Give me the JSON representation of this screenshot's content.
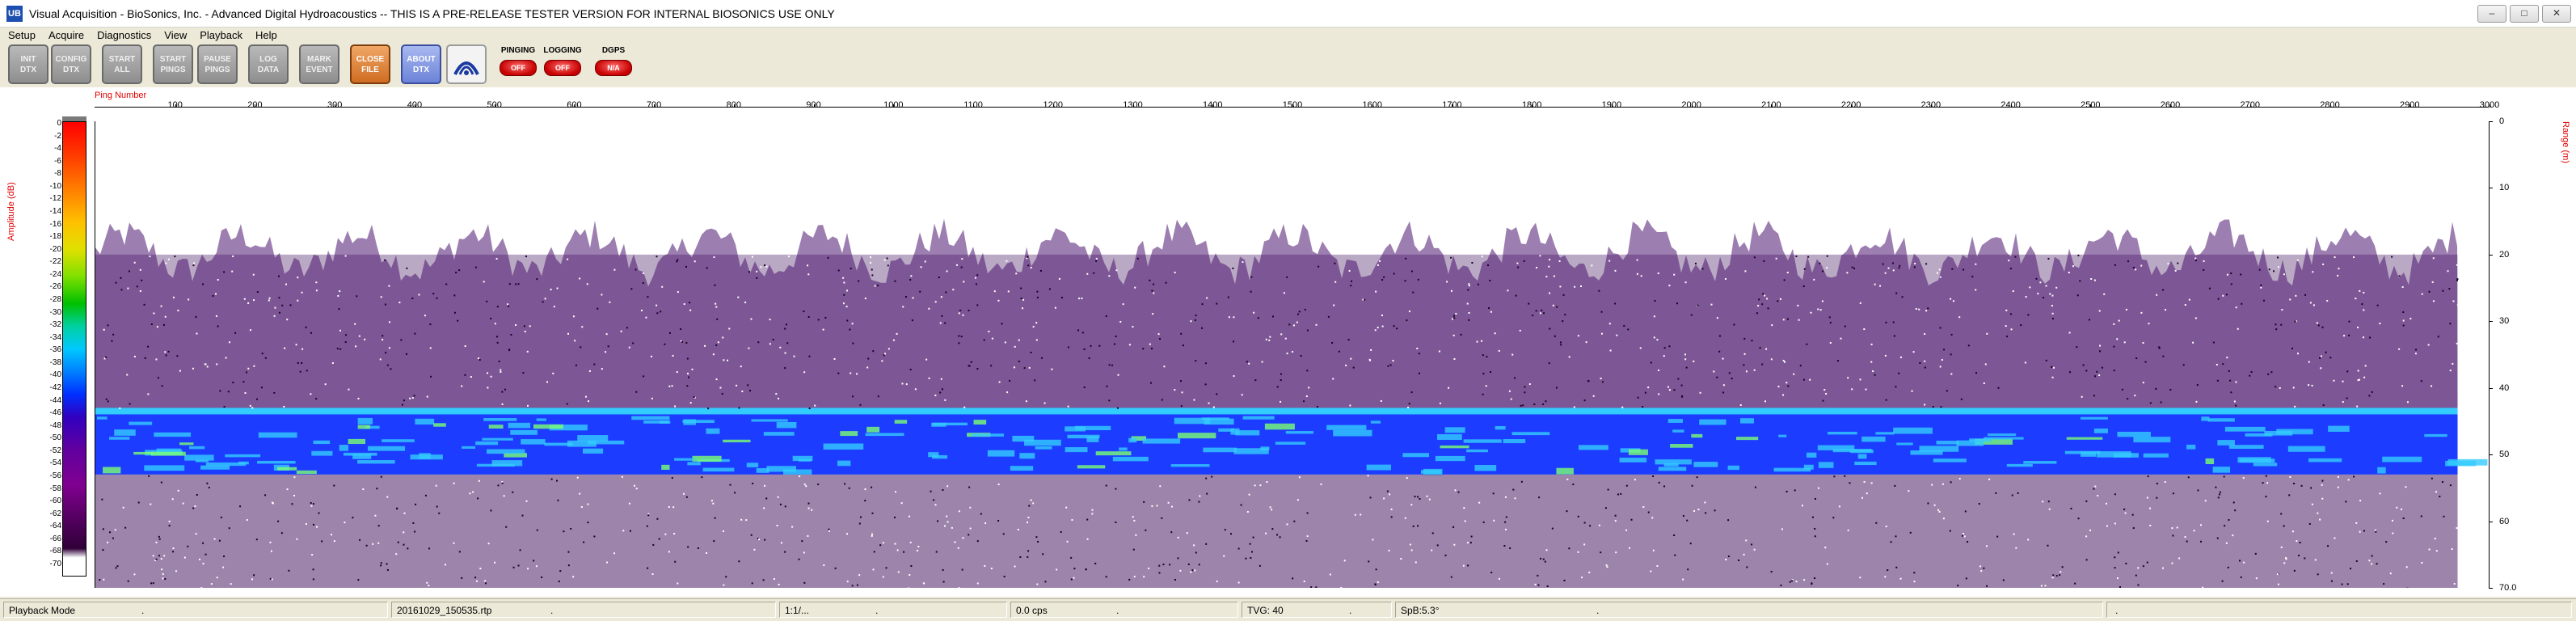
{
  "window": {
    "title": "Visual Acquisition  -  BioSonics, Inc.  -  Advanced Digital Hydroacoustics  -- THIS IS A PRE-RELEASE TESTER VERSION FOR INTERNAL BIOSONICS USE ONLY",
    "app_icon": "UB",
    "controls": [
      "–",
      "□",
      "✕"
    ]
  },
  "menu": [
    "Setup",
    "Acquire",
    "Diagnostics",
    "View",
    "Playback",
    "Help"
  ],
  "toolbar": {
    "buttons": [
      {
        "label": "INIT\nDTX",
        "style": "gray"
      },
      {
        "label": "CONFIG\nDTX",
        "style": "gray"
      },
      {
        "label": "START\nALL",
        "style": "gray"
      },
      {
        "label": "START\nPINGS",
        "style": "gray"
      },
      {
        "label": "PAUSE\nPINGS",
        "style": "gray"
      },
      {
        "label": "LOG\nDATA",
        "style": "gray"
      },
      {
        "label": "MARK\nEVENT",
        "style": "gray"
      },
      {
        "label": "CLOSE\nFILE",
        "style": "orange"
      },
      {
        "label": "ABOUT\nDTX",
        "style": "blue"
      }
    ],
    "logo_icon": "biosonics-logo-icon",
    "indicators": [
      {
        "label": "PINGING",
        "state": "OFF"
      },
      {
        "label": "LOGGING",
        "state": "OFF"
      },
      {
        "label": "DGPS",
        "state": "N/A"
      }
    ]
  },
  "echogram": {
    "x_axis_label": "Ping Number",
    "y_left_label": "Amplitude (dB)",
    "y_right_label": "Range (m)",
    "x_ticks": [
      "100",
      "200",
      "300",
      "400",
      "500",
      "600",
      "700",
      "800",
      "900",
      "1000",
      "1100",
      "1200",
      "1300",
      "1400",
      "1500",
      "1600",
      "1700",
      "1800",
      "1900",
      "2000",
      "2100",
      "2200",
      "2300",
      "2400",
      "2500",
      "2600",
      "2700",
      "2800",
      "2900",
      "3000"
    ],
    "x_max": 3000,
    "range_ticks": [
      "0",
      "10",
      "20",
      "30",
      "40",
      "50",
      "60",
      "70.0"
    ],
    "range_max": 70,
    "amplitude_ticks": [
      "0",
      "-2",
      "-4",
      "-6",
      "-8",
      "-10",
      "-12",
      "-14",
      "-16",
      "-18",
      "-20",
      "-22",
      "-24",
      "-26",
      "-28",
      "-30",
      "-32",
      "-34",
      "-36",
      "-38",
      "-40",
      "-42",
      "-44",
      "-46",
      "-48",
      "-50",
      "-52",
      "-54",
      "-56",
      "-58",
      "-60",
      "-62",
      "-64",
      "-66",
      "-68",
      "-70"
    ],
    "amplitude_min": -70,
    "last_ping": 2960,
    "noise_top_range_m": 20,
    "bottom_layer_range_m": [
      43,
      53
    ],
    "colors": {
      "layer_cyan": "#33ccff",
      "layer_blue": "#1c3cff",
      "noise_purple": "#3a0a55",
      "label_red": "#e00000"
    }
  },
  "statusbar": {
    "mode": "Playback Mode",
    "file": "20161029_150535.rtp",
    "ratio": "1:1/...",
    "cps": "0.0 cps",
    "tvg": "TVG: 40",
    "spb": "SpB:5.3°",
    "dots": "."
  }
}
